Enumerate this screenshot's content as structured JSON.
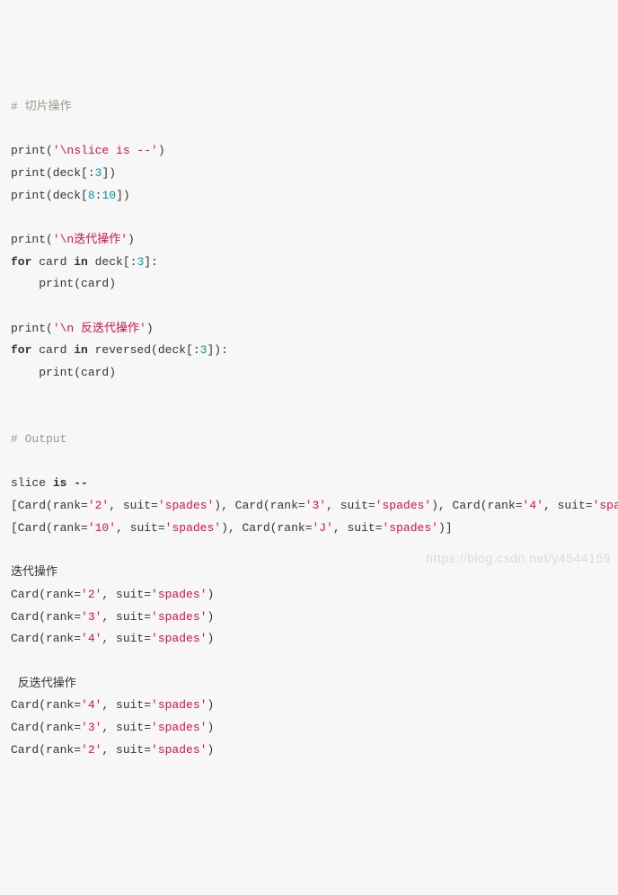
{
  "code_lines": [
    [
      {
        "c": "cm",
        "t": "# 切片操作"
      }
    ],
    [],
    [
      {
        "c": "pn",
        "t": "print("
      },
      {
        "c": "str",
        "t": "'\\nslice is --'"
      },
      {
        "c": "pn",
        "t": ")"
      }
    ],
    [
      {
        "c": "pn",
        "t": "print(deck[:"
      },
      {
        "c": "num",
        "t": "3"
      },
      {
        "c": "pn",
        "t": "])"
      }
    ],
    [
      {
        "c": "pn",
        "t": "print(deck["
      },
      {
        "c": "num",
        "t": "8"
      },
      {
        "c": "pn",
        "t": ":"
      },
      {
        "c": "num",
        "t": "10"
      },
      {
        "c": "pn",
        "t": "])"
      }
    ],
    [],
    [
      {
        "c": "pn",
        "t": "print("
      },
      {
        "c": "str",
        "t": "'\\n迭代操作'"
      },
      {
        "c": "pn",
        "t": ")"
      }
    ],
    [
      {
        "c": "kw",
        "t": "for"
      },
      {
        "c": "pn",
        "t": " card "
      },
      {
        "c": "kw",
        "t": "in"
      },
      {
        "c": "pn",
        "t": " deck[:"
      },
      {
        "c": "num",
        "t": "3"
      },
      {
        "c": "pn",
        "t": "]:"
      }
    ],
    [
      {
        "c": "pn",
        "t": "    print(card)"
      }
    ],
    [],
    [
      {
        "c": "pn",
        "t": "print("
      },
      {
        "c": "str",
        "t": "'\\n 反迭代操作'"
      },
      {
        "c": "pn",
        "t": ")"
      }
    ],
    [
      {
        "c": "kw",
        "t": "for"
      },
      {
        "c": "pn",
        "t": " card "
      },
      {
        "c": "kw",
        "t": "in"
      },
      {
        "c": "pn",
        "t": " reversed(deck[:"
      },
      {
        "c": "num",
        "t": "3"
      },
      {
        "c": "pn",
        "t": "]):"
      }
    ],
    [
      {
        "c": "pn",
        "t": "    print(card)"
      }
    ],
    [],
    [],
    [
      {
        "c": "cm",
        "t": "# Output"
      }
    ],
    [],
    [
      {
        "c": "pn",
        "t": "slice "
      },
      {
        "c": "kw",
        "t": "is"
      },
      {
        "c": "pn",
        "t": " "
      },
      {
        "c": "op",
        "t": "--"
      }
    ],
    [
      {
        "c": "pn",
        "t": "[Card(rank="
      },
      {
        "c": "str",
        "t": "'2'"
      },
      {
        "c": "pn",
        "t": ", suit="
      },
      {
        "c": "str",
        "t": "'spades'"
      },
      {
        "c": "pn",
        "t": "), Card(rank="
      },
      {
        "c": "str",
        "t": "'3'"
      },
      {
        "c": "pn",
        "t": ", suit="
      },
      {
        "c": "str",
        "t": "'spades'"
      },
      {
        "c": "pn",
        "t": "), Card(rank="
      },
      {
        "c": "str",
        "t": "'4'"
      },
      {
        "c": "pn",
        "t": ", suit="
      },
      {
        "c": "str",
        "t": "'spad"
      }
    ],
    [
      {
        "c": "pn",
        "t": "[Card(rank="
      },
      {
        "c": "str",
        "t": "'10'"
      },
      {
        "c": "pn",
        "t": ", suit="
      },
      {
        "c": "str",
        "t": "'spades'"
      },
      {
        "c": "pn",
        "t": "), Card(rank="
      },
      {
        "c": "str",
        "t": "'J'"
      },
      {
        "c": "pn",
        "t": ", suit="
      },
      {
        "c": "str",
        "t": "'spades'"
      },
      {
        "c": "pn",
        "t": ")]"
      }
    ],
    [],
    [
      {
        "c": "pn",
        "t": "迭代操作"
      }
    ],
    [
      {
        "c": "pn",
        "t": "Card(rank="
      },
      {
        "c": "str",
        "t": "'2'"
      },
      {
        "c": "pn",
        "t": ", suit="
      },
      {
        "c": "str",
        "t": "'spades'"
      },
      {
        "c": "pn",
        "t": ")"
      }
    ],
    [
      {
        "c": "pn",
        "t": "Card(rank="
      },
      {
        "c": "str",
        "t": "'3'"
      },
      {
        "c": "pn",
        "t": ", suit="
      },
      {
        "c": "str",
        "t": "'spades'"
      },
      {
        "c": "pn",
        "t": ")"
      }
    ],
    [
      {
        "c": "pn",
        "t": "Card(rank="
      },
      {
        "c": "str",
        "t": "'4'"
      },
      {
        "c": "pn",
        "t": ", suit="
      },
      {
        "c": "str",
        "t": "'spades'"
      },
      {
        "c": "pn",
        "t": ")"
      }
    ],
    [],
    [
      {
        "c": "pn",
        "t": " 反迭代操作"
      }
    ],
    [
      {
        "c": "pn",
        "t": "Card(rank="
      },
      {
        "c": "str",
        "t": "'4'"
      },
      {
        "c": "pn",
        "t": ", suit="
      },
      {
        "c": "str",
        "t": "'spades'"
      },
      {
        "c": "pn",
        "t": ")"
      }
    ],
    [
      {
        "c": "pn",
        "t": "Card(rank="
      },
      {
        "c": "str",
        "t": "'3'"
      },
      {
        "c": "pn",
        "t": ", suit="
      },
      {
        "c": "str",
        "t": "'spades'"
      },
      {
        "c": "pn",
        "t": ")"
      }
    ],
    [
      {
        "c": "pn",
        "t": "Card(rank="
      },
      {
        "c": "str",
        "t": "'2'"
      },
      {
        "c": "pn",
        "t": ", suit="
      },
      {
        "c": "str",
        "t": "'spades'"
      },
      {
        "c": "pn",
        "t": ")"
      }
    ]
  ],
  "watermark": "https://blog.csdn.net/y4544159"
}
